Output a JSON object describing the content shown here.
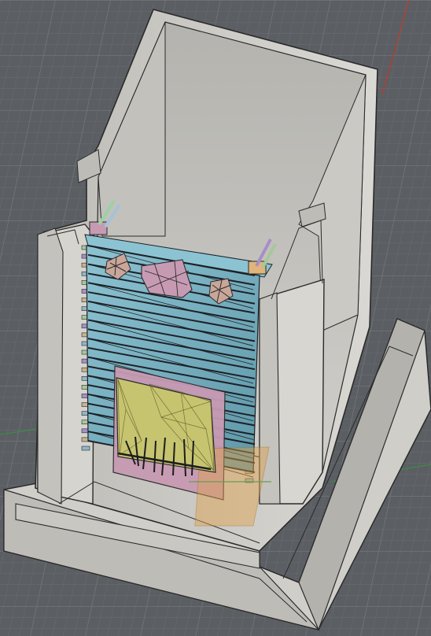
{
  "viewport": {
    "app": "3D CAD viewport",
    "view": "isometric",
    "grid": true
  },
  "colors": {
    "background": "#5b5f63",
    "grid_minor": "#686c70",
    "grid_major": "#72767a",
    "axis_red": "#c0392b",
    "axis_green": "#3d8b48",
    "body_light": "#dcdbd6",
    "body_mid": "#c6c5c0",
    "body_dark": "#a9a8a3",
    "body_edge": "#2b2b2b",
    "stack_blue": "#7db3c4",
    "stack_dark": "#1d2126",
    "board_pink": "#c79ab3",
    "chip_yellow": "#c6c46f",
    "pin_green": "#a6c79a",
    "pin_purple": "#a48fc7",
    "orange_plane": "#e0a14a"
  },
  "objects": [
    {
      "name": "enclosure-body"
    },
    {
      "name": "card-stack"
    },
    {
      "name": "connector-board"
    },
    {
      "name": "chip-module"
    }
  ]
}
